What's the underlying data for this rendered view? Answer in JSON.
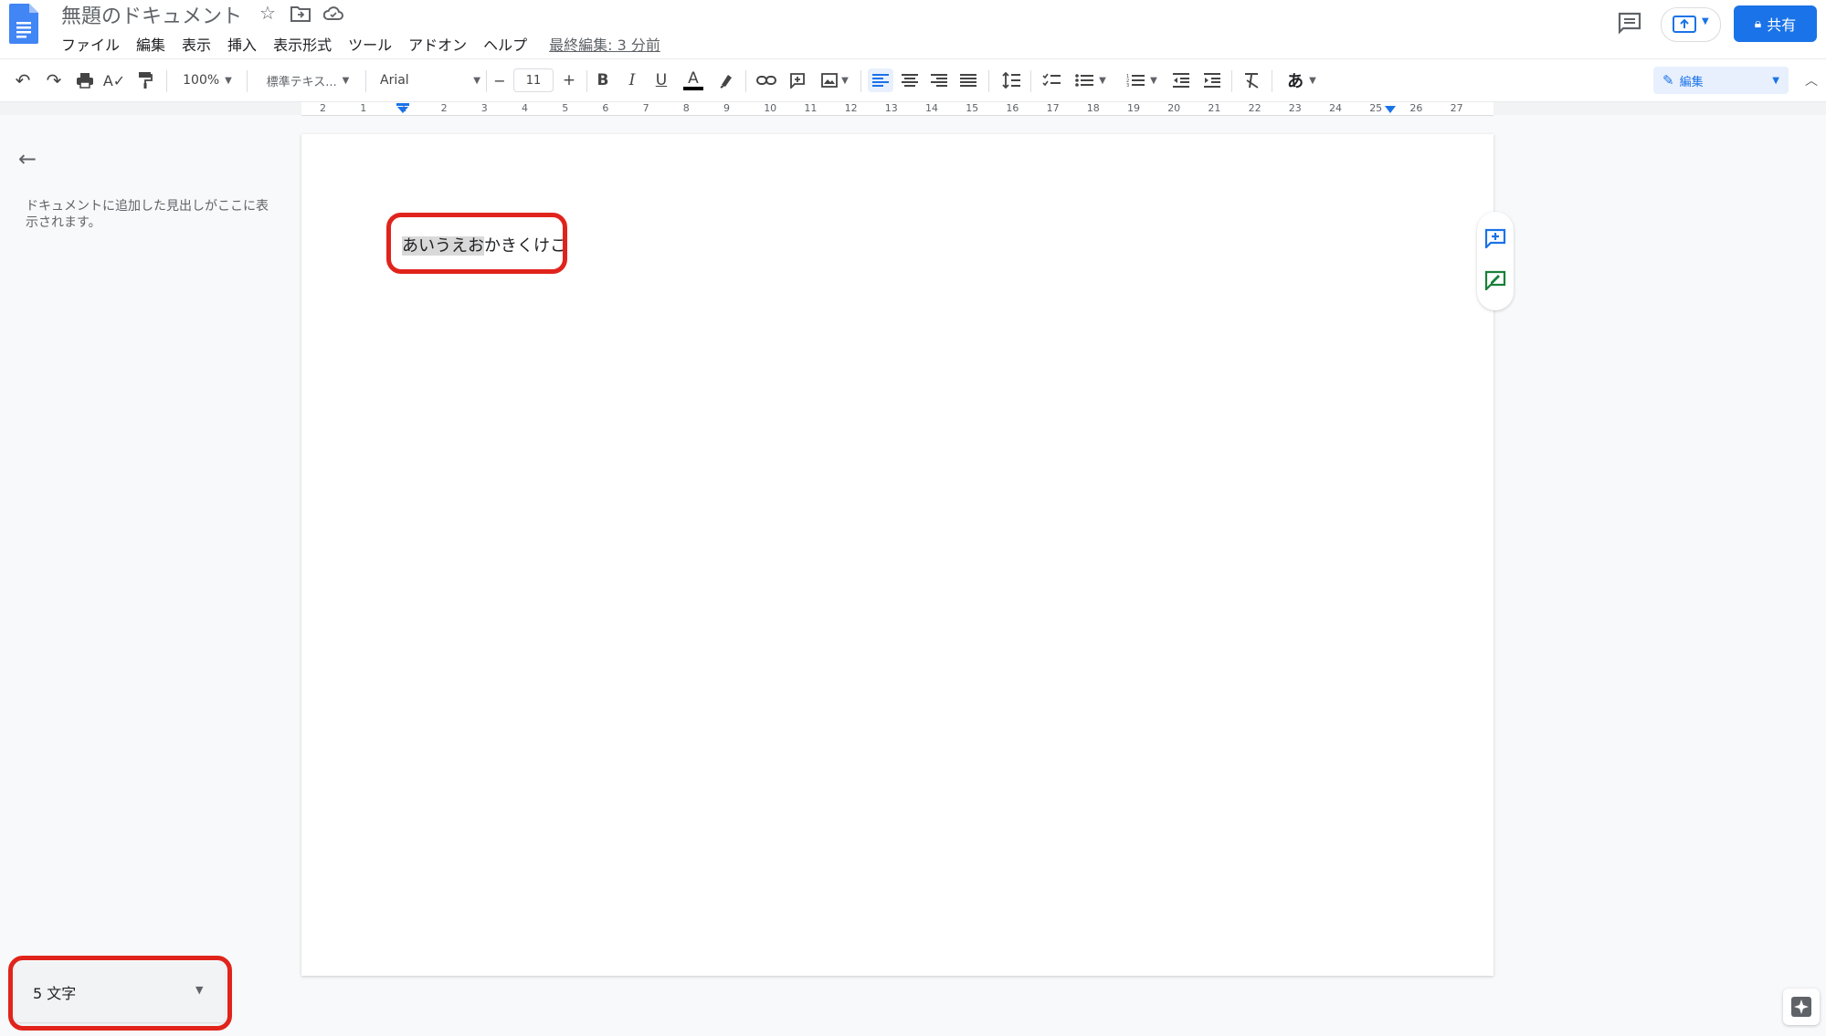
{
  "header": {
    "title": "無題のドキュメント",
    "menu": [
      "ファイル",
      "編集",
      "表示",
      "挿入",
      "表示形式",
      "ツール",
      "アドオン",
      "ヘルプ"
    ],
    "last_edit": "最終編集: 3 分前",
    "share_label": "共有"
  },
  "toolbar": {
    "zoom": "100%",
    "style": "標準テキス...",
    "font": "Arial",
    "font_size": "11",
    "minus": "−",
    "plus": "+",
    "bold": "B",
    "italic": "I",
    "underline": "U",
    "text_color": "A",
    "input_tools": "あ",
    "mode_label": "編集"
  },
  "ruler": {
    "ticks": [
      "2",
      "1",
      "1",
      "2",
      "3",
      "4",
      "5",
      "6",
      "7",
      "8",
      "9",
      "10",
      "11",
      "12",
      "13",
      "14",
      "15",
      "16",
      "17",
      "18",
      "19",
      "20",
      "21",
      "22",
      "23",
      "24",
      "25",
      "26",
      "27"
    ]
  },
  "outline": {
    "hint": "ドキュメントに追加した見出しがここに表示されます。"
  },
  "document": {
    "selected_text": "あいうえお",
    "rest_text": "かきくけこ"
  },
  "word_count": {
    "label": "5 文字"
  },
  "colors": {
    "accent": "#1a73e8",
    "highlight_border": "#e0241b"
  }
}
